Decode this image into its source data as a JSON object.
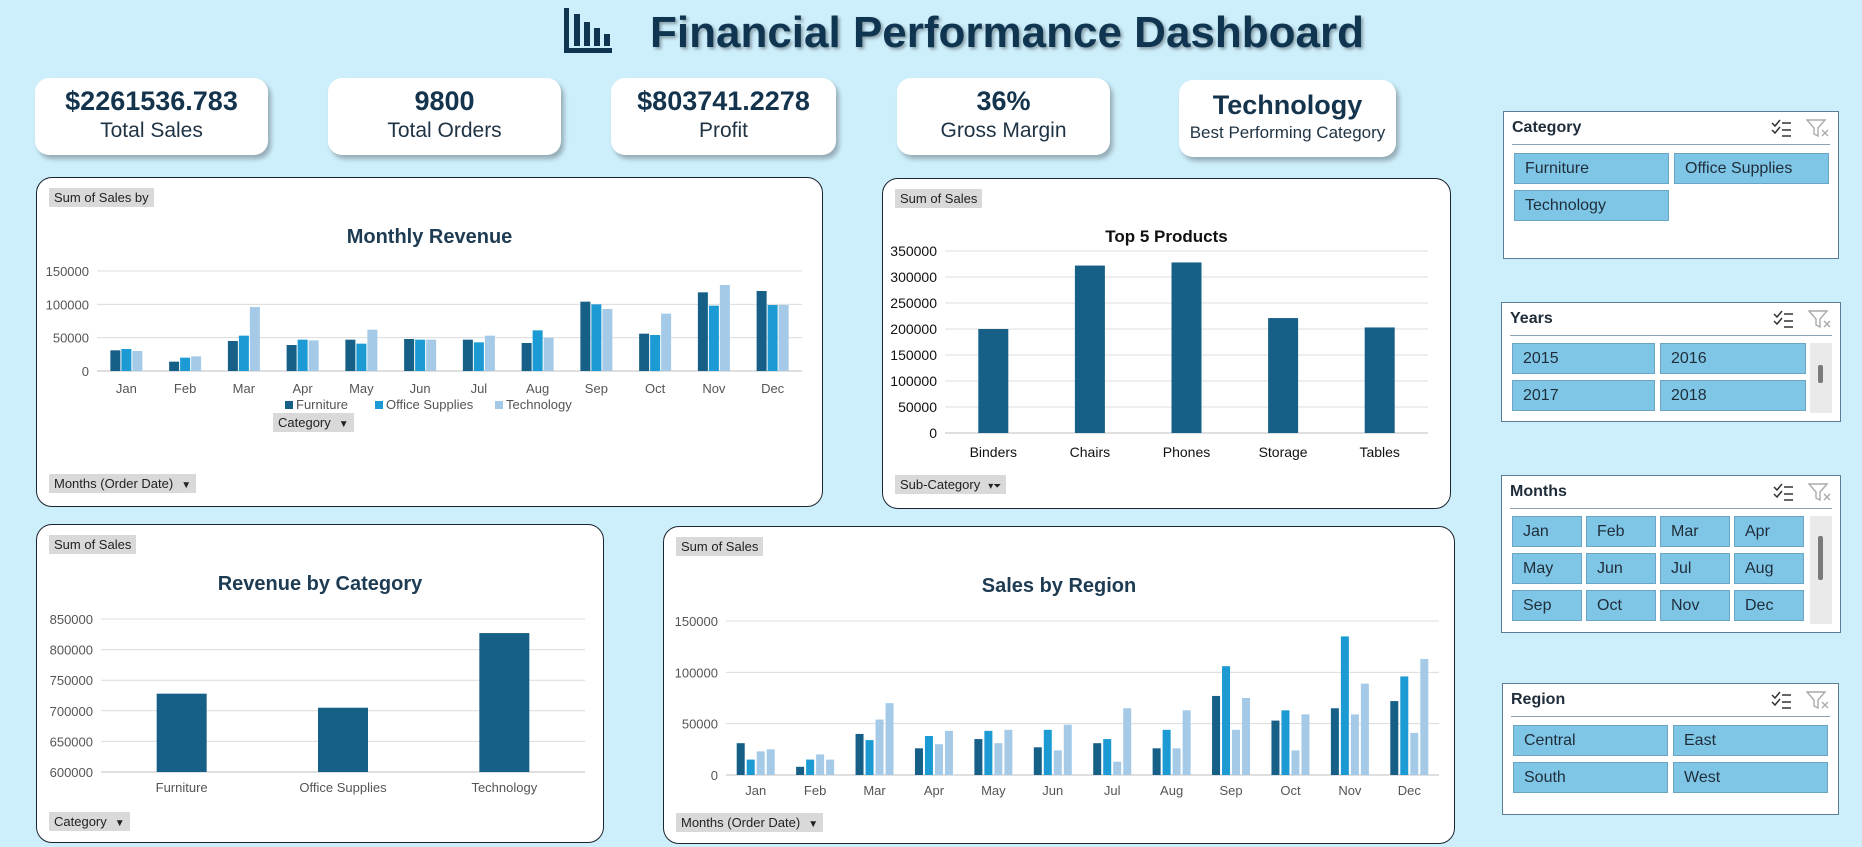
{
  "header": {
    "title": "Financial Performance Dashboard",
    "icon": "bar-chart-icon"
  },
  "kpis": [
    {
      "value": "$2261536.783",
      "label": "Total Sales"
    },
    {
      "value": "9800",
      "label": "Total Orders"
    },
    {
      "value": "$803741.2278",
      "label": "Profit"
    },
    {
      "value": "36%",
      "label": "Gross Margin"
    },
    {
      "value": "Technology",
      "label": "Best Performing Category"
    }
  ],
  "monthly_revenue": {
    "tag": "Sum of Sales by",
    "category_field": "Category",
    "axis_field": "Months (Order Date)"
  },
  "top_products": {
    "tag": "Sum of Sales",
    "axis_field": "Sub-Category"
  },
  "revenue_by_category": {
    "tag": "Sum of Sales",
    "axis_field": "Category"
  },
  "sales_by_region": {
    "tag": "Sum of Sales",
    "axis_field": "Months (Order Date)"
  },
  "colors": {
    "dark": "#166088",
    "mid": "#1b9ad3",
    "light": "#a4cae8",
    "bar": "#166088"
  },
  "slicers": {
    "category": {
      "title": "Category",
      "items": [
        "Furniture",
        "Office Supplies",
        "Technology"
      ]
    },
    "years": {
      "title": "Years",
      "items": [
        "2015",
        "2016",
        "2017",
        "2018"
      ]
    },
    "months": {
      "title": "Months",
      "items": [
        "Jan",
        "Feb",
        "Mar",
        "Apr",
        "May",
        "Jun",
        "Jul",
        "Aug",
        "Sep",
        "Oct",
        "Nov",
        "Dec"
      ]
    },
    "region": {
      "title": "Region",
      "items": [
        "Central",
        "East",
        "South",
        "West"
      ]
    }
  },
  "chart_data": [
    {
      "type": "bar",
      "title": "Monthly Revenue",
      "categories": [
        "Jan",
        "Feb",
        "Mar",
        "Apr",
        "May",
        "Jun",
        "Jul",
        "Aug",
        "Sep",
        "Oct",
        "Nov",
        "Dec"
      ],
      "series": [
        {
          "name": "Furniture",
          "values": [
            31000,
            14000,
            45000,
            39000,
            47000,
            48000,
            47000,
            42000,
            104000,
            56000,
            118000,
            120000
          ]
        },
        {
          "name": "Office Supplies",
          "values": [
            33000,
            20000,
            53000,
            47000,
            41000,
            47000,
            43000,
            61000,
            100000,
            54000,
            98000,
            99000
          ]
        },
        {
          "name": "Technology",
          "values": [
            30000,
            22000,
            96000,
            46000,
            62000,
            47000,
            53000,
            50000,
            93000,
            86000,
            129000,
            99000
          ]
        }
      ],
      "yticks": [
        0,
        50000,
        100000,
        150000
      ],
      "ylim": [
        0,
        150000
      ],
      "legend": "bottom"
    },
    {
      "type": "bar",
      "title": "Top 5 Products",
      "categories": [
        "Binders",
        "Chairs",
        "Phones",
        "Storage",
        "Tables"
      ],
      "values": [
        200000,
        322000,
        328000,
        221000,
        203000
      ],
      "yticks": [
        0,
        50000,
        100000,
        150000,
        200000,
        250000,
        300000,
        350000
      ],
      "ylim": [
        0,
        350000
      ]
    },
    {
      "type": "bar",
      "title": "Revenue by Category",
      "categories": [
        "Furniture",
        "Office Supplies",
        "Technology"
      ],
      "values": [
        728000,
        705000,
        827000
      ],
      "yticks": [
        600000,
        650000,
        700000,
        750000,
        800000,
        850000
      ],
      "ylim": [
        600000,
        850000
      ]
    },
    {
      "type": "bar",
      "title": "Sales by Region",
      "categories": [
        "Jan",
        "Feb",
        "Mar",
        "Apr",
        "May",
        "Jun",
        "Jul",
        "Aug",
        "Sep",
        "Oct",
        "Nov",
        "Dec"
      ],
      "series": [
        {
          "values": [
            31000,
            8000,
            40000,
            26000,
            35000,
            27000,
            31000,
            26000,
            77000,
            53000,
            65000,
            72000
          ]
        },
        {
          "values": [
            15000,
            15000,
            34000,
            38000,
            43000,
            44000,
            35000,
            44000,
            106000,
            63000,
            135000,
            96000
          ]
        },
        {
          "values": [
            23000,
            20000,
            54000,
            30000,
            31000,
            24000,
            13000,
            26000,
            44000,
            24000,
            59000,
            41000
          ]
        },
        {
          "values": [
            25000,
            15000,
            70000,
            43000,
            44000,
            49000,
            65000,
            63000,
            75000,
            59000,
            89000,
            113000
          ]
        }
      ],
      "yticks": [
        0,
        50000,
        100000,
        150000
      ],
      "ylim": [
        0,
        150000
      ]
    }
  ]
}
